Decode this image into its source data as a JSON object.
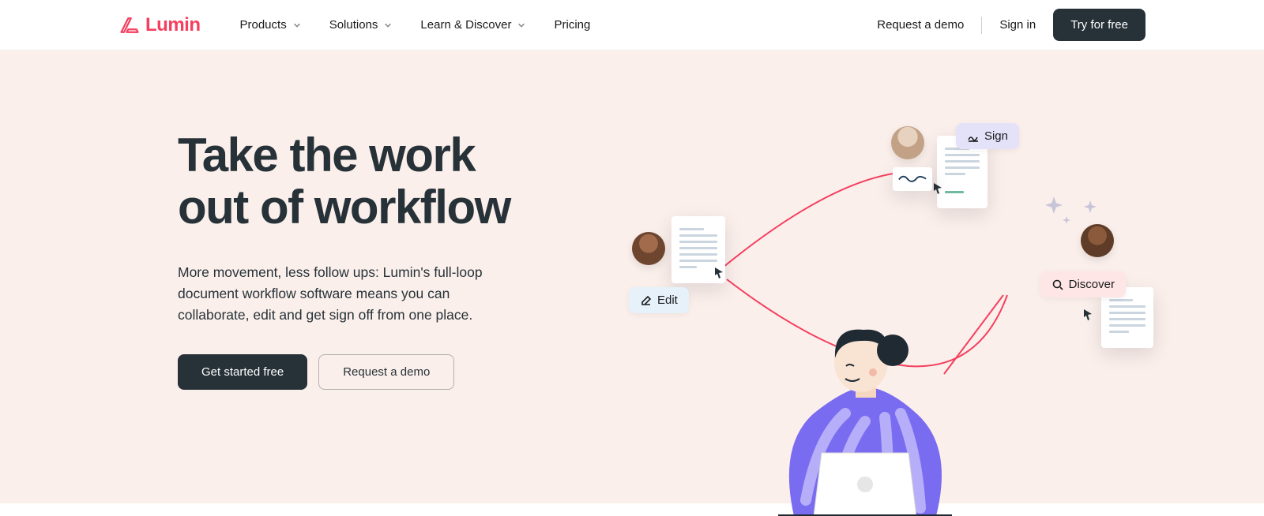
{
  "brand": {
    "name": "Lumin"
  },
  "nav": {
    "items": [
      {
        "label": "Products",
        "has_dropdown": true
      },
      {
        "label": "Solutions",
        "has_dropdown": true
      },
      {
        "label": "Learn & Discover",
        "has_dropdown": true
      },
      {
        "label": "Pricing",
        "has_dropdown": false
      }
    ]
  },
  "header_actions": {
    "demo": "Request a demo",
    "signin": "Sign in",
    "try": "Try for free"
  },
  "hero": {
    "headline_l1": "Take the work",
    "headline_l2": "out of workflow",
    "subtext": "More movement, less follow ups: Lumin's full-loop document workflow software means you can collaborate, edit and get sign off from one place.",
    "cta_primary": "Get started free",
    "cta_secondary": "Request a demo"
  },
  "illustration": {
    "pill_sign": "Sign",
    "pill_edit": "Edit",
    "pill_discover": "Discover"
  }
}
